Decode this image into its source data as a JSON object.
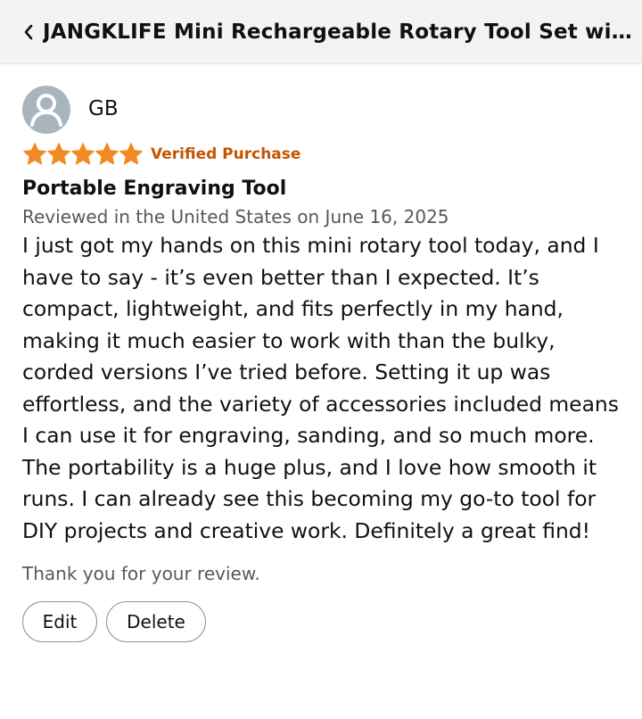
{
  "header": {
    "title": "JANGKLIFE Mini Rechargeable Rotary Tool Set wit...",
    "back_icon": "chevron-left-icon"
  },
  "review": {
    "reviewer": "GB",
    "avatar_icon": "user-silhouette-icon",
    "rating": 5,
    "rating_max": 5,
    "star_color": "#f08a24",
    "verified_label": "Verified Purchase",
    "verified_color": "#c45500",
    "title": "Portable Engraving Tool",
    "date_line": "Reviewed in the United States on June 16, 2025",
    "body": "I just got my hands on this mini rotary tool today, and I have to say - it’s even better than I expected. It’s compact, lightweight, and fits perfectly in my hand, making it much easier to work with than the bulky, corded versions I’ve tried before. Setting it up was effortless, and the variety of accessories included means I can use it for engraving, sanding, and so much more. The portability is a huge plus, and I love how smooth it runs. I can already see this becoming my go-to tool for DIY projects and creative work. Definitely a great find!"
  },
  "footer": {
    "thanks": "Thank you for your review.",
    "edit_label": "Edit",
    "delete_label": "Delete"
  }
}
